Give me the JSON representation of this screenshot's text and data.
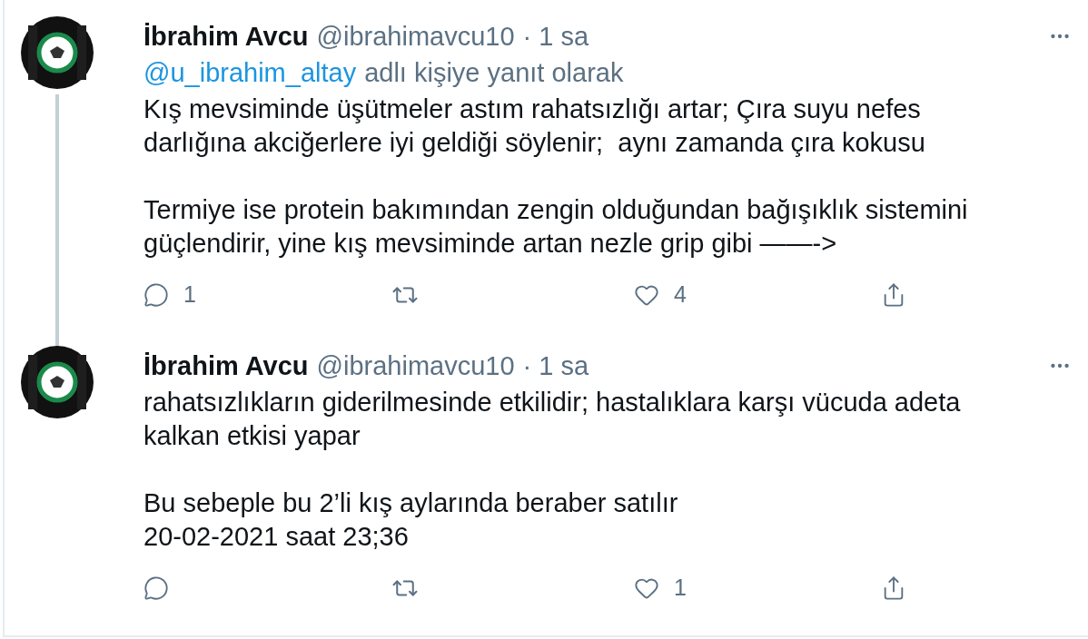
{
  "tweets": [
    {
      "name": "İbrahim Avcu",
      "handle": "@ibrahimavcu10",
      "time": "· 1 sa",
      "reply_to": {
        "mention": "@u_ibrahim_altay",
        "text": "adlı kişiye yanıt olarak"
      },
      "thread_line": true,
      "paragraphs": [
        [
          "Kış mevsiminde üşütmeler astım rahatsızlığı artar; Çıra suyu nefes",
          "darlığına akciğerlere iyi geldiği söylenir;  aynı zamanda çıra kokusu"
        ],
        [
          "Termiye ise protein bakımından zengin olduğundan bağışıklık sistemini",
          "güçlendirir, yine kış mevsiminde artan nezle grip gibi ——->"
        ]
      ],
      "actions": {
        "replies": "1",
        "likes": "4"
      }
    },
    {
      "name": "İbrahim Avcu",
      "handle": "@ibrahimavcu10",
      "time": "· 1 sa",
      "paragraphs": [
        [
          "rahatsızlıkların giderilmesinde etkilidir; hastalıklara karşı vücuda adeta",
          "kalkan etkisi yapar"
        ],
        [
          "Bu sebeple bu 2’li kış aylarında beraber satılır",
          "20-02-2021 saat 23;36"
        ]
      ],
      "actions": {
        "likes": "1"
      }
    }
  ]
}
